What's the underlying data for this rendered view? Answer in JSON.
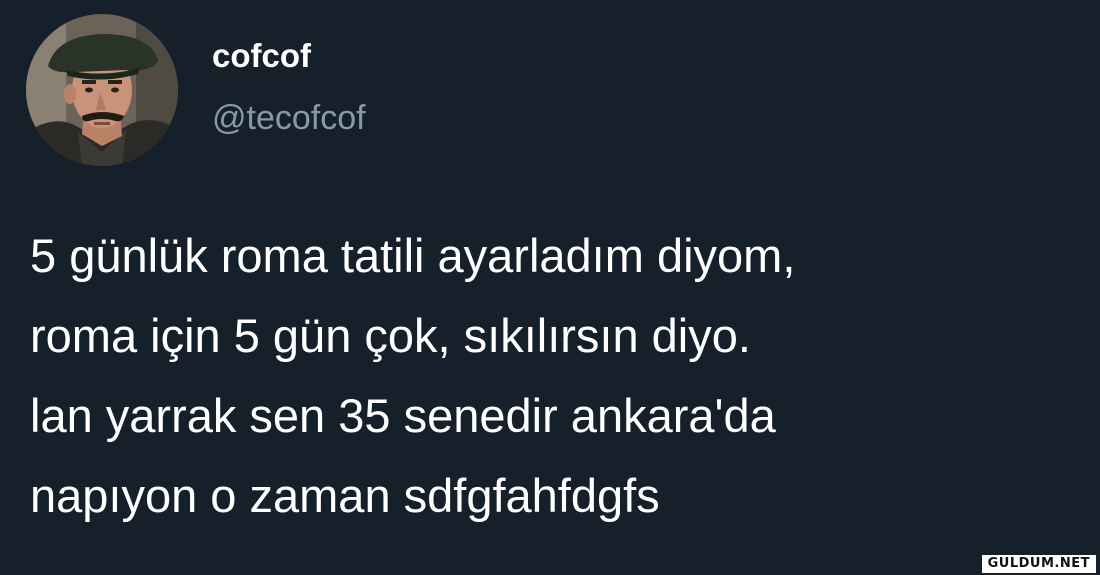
{
  "user": {
    "display_name": "cofcof",
    "handle": "@tecofcof",
    "avatar_icon": "profile-photo-man-with-beret-and-mustache"
  },
  "tweet": {
    "lines": [
      "5 günlük roma tatili ayarladım diyom,",
      "roma için 5 gün çok, sıkılırsın diyo.",
      "lan yarrak sen 35 senedir ankara'da",
      "napıyon o zaman sdfgfahfdgfs"
    ]
  },
  "watermark": {
    "text": "GULDUM.NET"
  },
  "colors": {
    "background": "#15202b",
    "primary_text": "#ffffff",
    "secondary_text": "#8899a6"
  }
}
